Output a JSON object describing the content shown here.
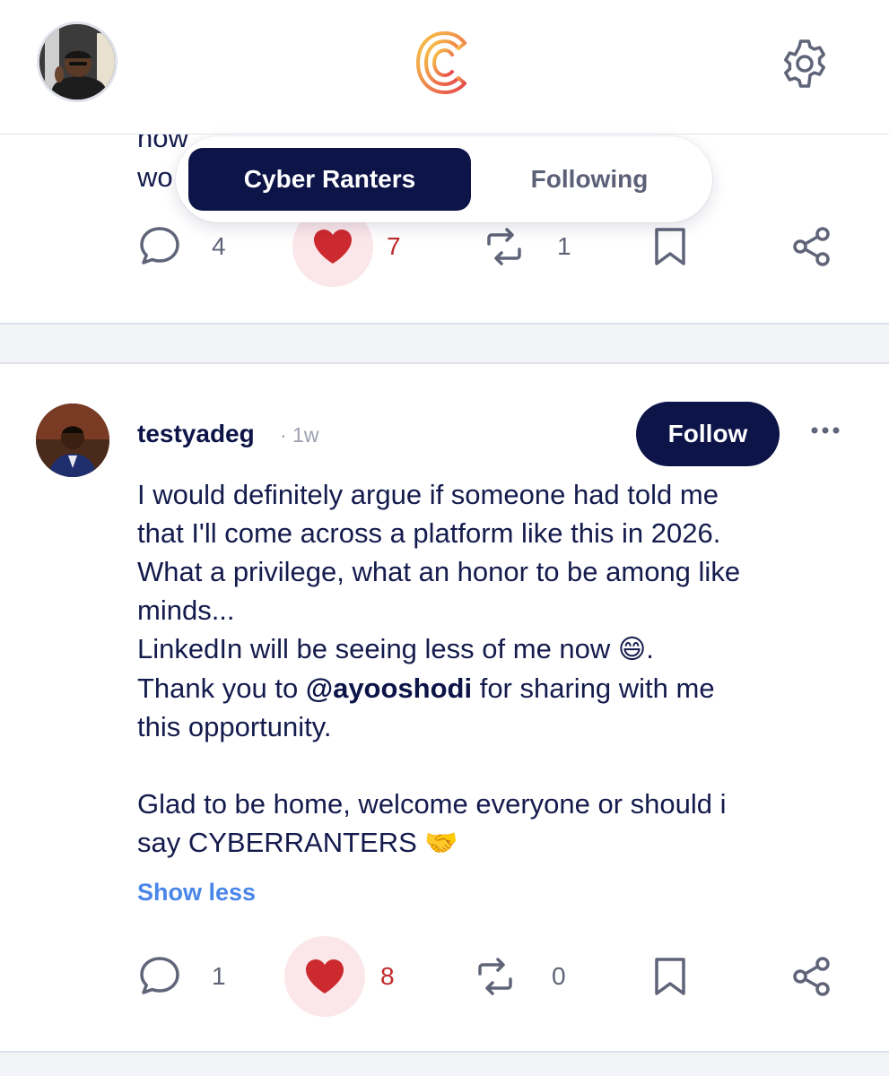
{
  "header": {
    "avatar_alt": "Profile",
    "logo_name": "app-logo",
    "settings_icon": "gear-icon"
  },
  "tabs": {
    "active": "Cyber Ranters",
    "inactive": "Following"
  },
  "post1": {
    "text_lines": [
      "now",
      "wo"
    ],
    "comments": "4",
    "likes": "7",
    "reposts": "1",
    "liked": true
  },
  "post2": {
    "author": "testyadeg",
    "time": "· 1w",
    "follow_label": "Follow",
    "body": {
      "line1": "I would definitely argue if someone had told me",
      "line2": "that I'll come across a platform like this in 2026.",
      "line3": "What a privilege, what an honor to be among like",
      "line4": "minds...",
      "line5": "LinkedIn will be seeing less of me now ",
      "line5_emoji": "😄",
      "line5_end": ".",
      "line6_start": "Thank you to ",
      "mention": "@ayooshodi",
      "line6_end": " for sharing with me",
      "line7": "this opportunity.",
      "line8": "Glad to be home, welcome everyone or should i",
      "line9": "say CYBERRANTERS ",
      "line9_emoji": "🤝"
    },
    "show_less": "Show less",
    "comments": "1",
    "likes": "8",
    "reposts": "0",
    "liked": true
  },
  "colors": {
    "navy": "#0c1448",
    "like_red": "#c0292b",
    "link_blue": "#4a86e8",
    "icon_gray": "#5f6478"
  }
}
